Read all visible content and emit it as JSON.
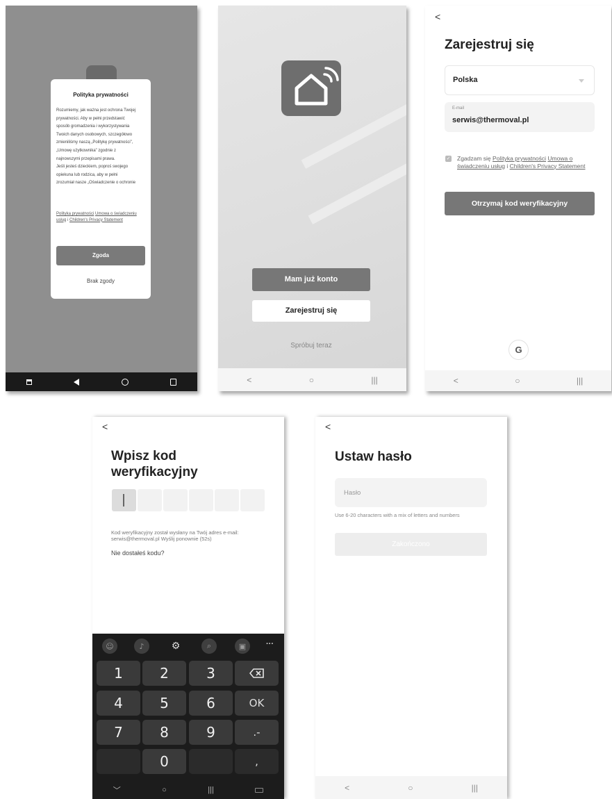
{
  "screen1": {
    "dialog_title": "Polityka prywatności",
    "body_lines": [
      "Rozumiemy, jak ważna jest ochrona Twojej",
      "prywatności. Aby w pełni przedstawić",
      "sposób gromadzenia i wykorzystywania",
      "Twoich danych osobowych, szczegółowo",
      "zmieniliśmy naszą „Politykę prywatności”,",
      "„Umowę użytkownika” zgodnie z",
      "najnowszymi przepisami prawa.",
      "Jeśli jesteś dzieckiem, poproś swojego",
      "opiekuna lub rodzica, aby w pełni",
      "zrozumiał nasze „Oświadczenie o ochronie"
    ],
    "links": {
      "privacy": "Polityka prywatności",
      "terms": "Umowa o świadczeniu usług",
      "connector": " i ",
      "children": "Children's Privacy Statement"
    },
    "agree_label": "Zgoda",
    "disagree_label": "Brak zgody",
    "nav_icons": [
      "recent-apps",
      "back",
      "home",
      "overview"
    ]
  },
  "screen2": {
    "login_label": "Mam już konto",
    "register_label": "Zarejestruj się",
    "try_label": "Spróbuj teraz",
    "nav": {
      "back": "<",
      "home": "○",
      "recent": "|||"
    }
  },
  "screen3": {
    "back": "<",
    "title": "Zarejestruj się",
    "country": "Polska",
    "email_label": "E-mail",
    "email_value": "serwis@thermoval.pl",
    "consent_prefix": "Zgadzam się ",
    "consent_privacy": "Polityka prywatności",
    "consent_terms": "Umowa o świadczeniu usług",
    "consent_connector": " i ",
    "consent_children": "Children's Privacy Statement",
    "get_code_label": "Otrzymaj kod weryfikacyjny",
    "google_letter": "G",
    "nav": {
      "back": "<",
      "home": "○",
      "recent": "|||"
    }
  },
  "screen4": {
    "back": "<",
    "title_line1": "Wpisz kod",
    "title_line2": "weryfikacyjny",
    "info_line1": "Kod weryfikacyjny został wysłany na Twój adres e-mail:",
    "info_line2": "serwis@thermoval.pl Wyślij ponownie (52s)",
    "no_code": "Nie dostałeś kodu?",
    "keyboard": {
      "keys": [
        "1",
        "2",
        "3",
        "4",
        "5",
        "6",
        "7",
        "8",
        "9",
        "0"
      ],
      "ok": "OK",
      "dash": ".-",
      "comma": ",",
      "more": "···"
    },
    "nav": {
      "down": "﹀",
      "home": "○",
      "recent": "|||"
    }
  },
  "screen5": {
    "back": "<",
    "title": "Ustaw hasło",
    "password_placeholder": "Hasło",
    "hint": "Use 6-20 characters with a mix of letters and numbers",
    "done_label": "Zakończono",
    "nav": {
      "back": "<",
      "home": "○",
      "recent": "|||"
    }
  }
}
